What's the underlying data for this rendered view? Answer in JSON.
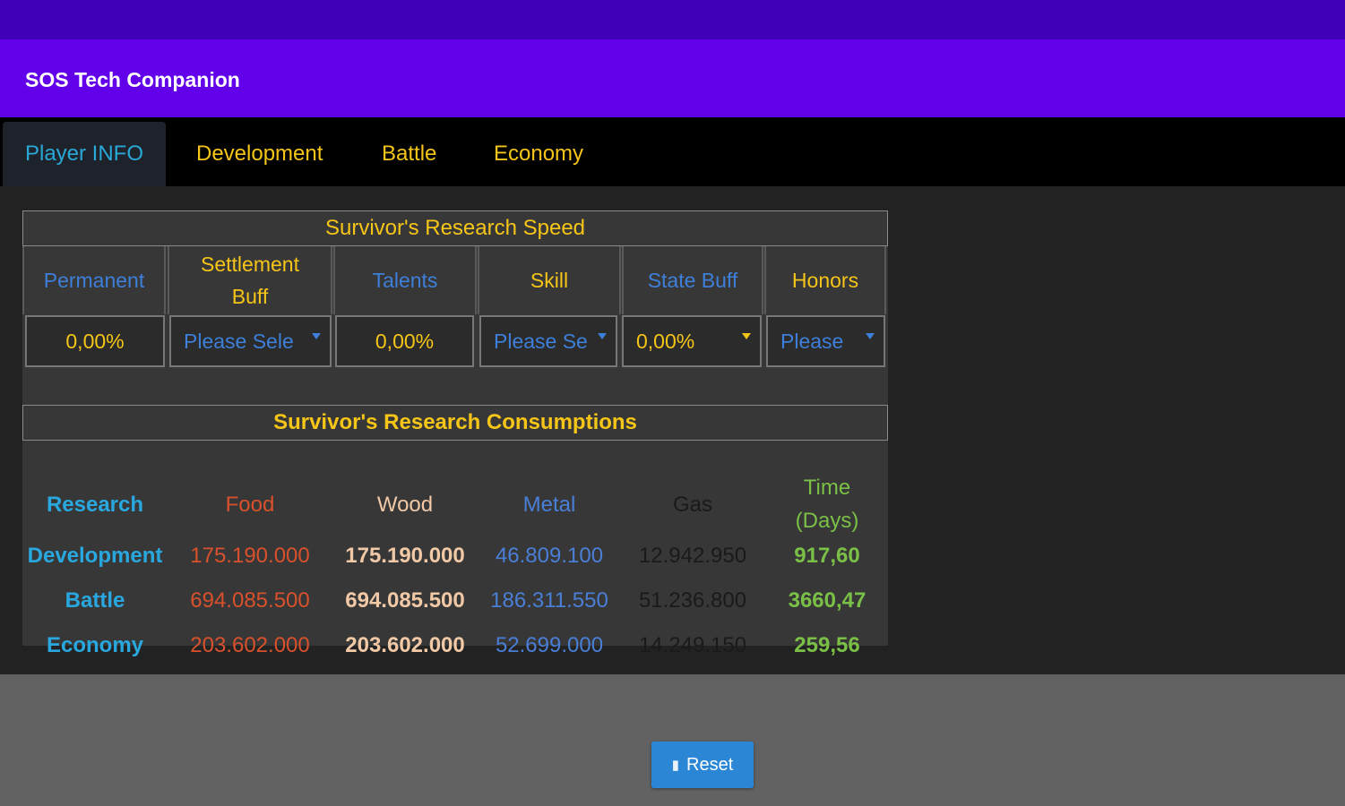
{
  "app": {
    "title": "SOS Tech Companion"
  },
  "tabs": [
    {
      "label": "Player INFO"
    },
    {
      "label": "Development"
    },
    {
      "label": "Battle"
    },
    {
      "label": "Economy"
    }
  ],
  "speed": {
    "title": "Survivor's Research Speed",
    "headers": [
      "Permanent",
      "Settlement\nBuff",
      "Talents",
      "Skill",
      "State Buff",
      "Honors"
    ],
    "values": [
      "0,00%",
      "Please Sele",
      "0,00%",
      "Please Se",
      "0,00%",
      "Please"
    ]
  },
  "consumption": {
    "title": "Survivor's Research Consumptions",
    "columns": [
      "Research",
      "Food",
      "Wood",
      "Metal",
      "Gas",
      "Time\n(Days)"
    ],
    "rows": [
      {
        "research": "Development",
        "food": "175.190.000",
        "wood": "175.190.000",
        "metal": "46.809.100",
        "gas": "12.942.950",
        "time": "917,60"
      },
      {
        "research": "Battle",
        "food": "694.085.500",
        "wood": "694.085.500",
        "metal": "186.311.550",
        "gas": "51.236.800",
        "time": "3660,47"
      },
      {
        "research": "Economy",
        "food": "203.602.000",
        "wood": "203.602.000",
        "metal": "52.699.000",
        "gas": "14.249.150",
        "time": "259,56"
      }
    ]
  },
  "footer": {
    "reset_label": "Reset"
  },
  "icons": {
    "reset": "trash-icon",
    "dropdown": "caret-down-icon"
  }
}
